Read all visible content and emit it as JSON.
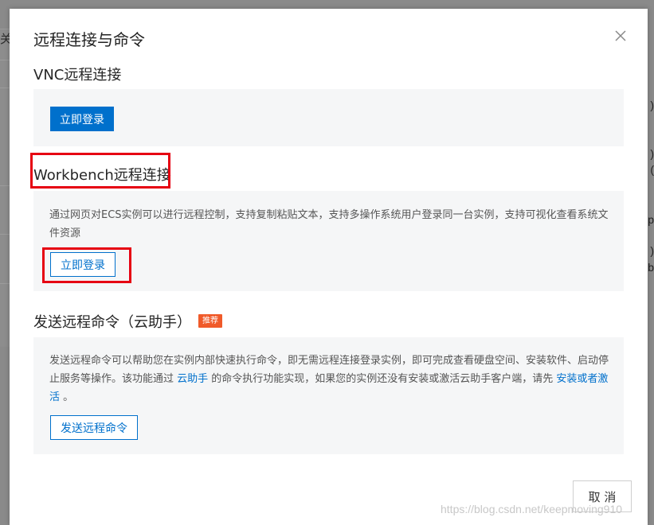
{
  "background": {
    "left_fragment": "关",
    "right_fragments": [
      ")",
      ")",
      "(",
      "p",
      ")",
      "lb"
    ]
  },
  "dialog": {
    "title": "远程连接与命令",
    "close_icon": "close-icon"
  },
  "vnc": {
    "title": "VNC远程连接",
    "login_label": "立即登录"
  },
  "workbench": {
    "title": "Workbench远程连接",
    "description": "通过网页对ECS实例可以进行远程控制，支持复制粘贴文本，支持多操作系统用户登录同一台实例，支持可视化查看系统文件资源",
    "login_label": "立即登录"
  },
  "remote_command": {
    "title": "发送远程命令（云助手）",
    "badge": "推荐",
    "desc_part1": "发送远程命令可以帮助您在实例内部快速执行命令，即无需远程连接登录实例，即可完成查看硬盘空间、安装软件、启动停止服务等操作。该功能通过 ",
    "link1": "云助手",
    "desc_part2": " 的命令执行功能实现，如果您的实例还没有安装或激活云助手客户端，请先 ",
    "link2": "安装或者激活",
    "desc_part3": " 。",
    "send_label": "发送远程命令"
  },
  "footer": {
    "cancel_label": "取 消"
  },
  "watermark": "https://blog.csdn.net/keepmoving910",
  "colors": {
    "primary": "#0070cc",
    "highlight_box": "#e60012",
    "badge": "#f05a2a",
    "panel_bg": "#f5f6f7",
    "overlay": "#7f7f7f"
  }
}
